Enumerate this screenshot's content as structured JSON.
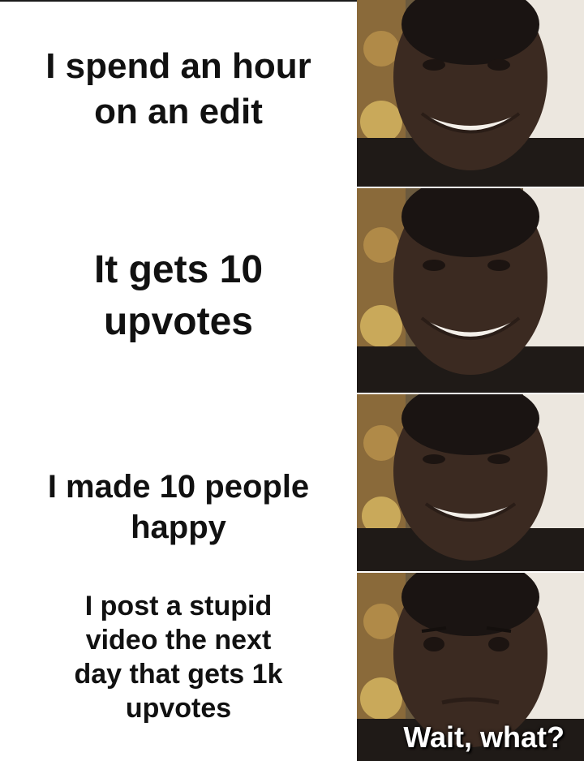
{
  "captions": [
    {
      "line1": "I spend an hour",
      "line2": "on an edit"
    },
    {
      "line1": "It gets 10",
      "line2": "upvotes"
    },
    {
      "line1": "I made 10 people",
      "line2": "happy"
    },
    {
      "line1": "I post a stupid",
      "line2": "video the next",
      "line3": "day that gets 1k",
      "line4": "upvotes"
    }
  ],
  "panel4_overlay": "Wait, what?",
  "panels": [
    {
      "expression": "smiling"
    },
    {
      "expression": "smiling"
    },
    {
      "expression": "smiling"
    },
    {
      "expression": "confused"
    }
  ],
  "colors": {
    "text": "#111111",
    "background": "#ffffff",
    "overlay_text": "#ffffff"
  }
}
